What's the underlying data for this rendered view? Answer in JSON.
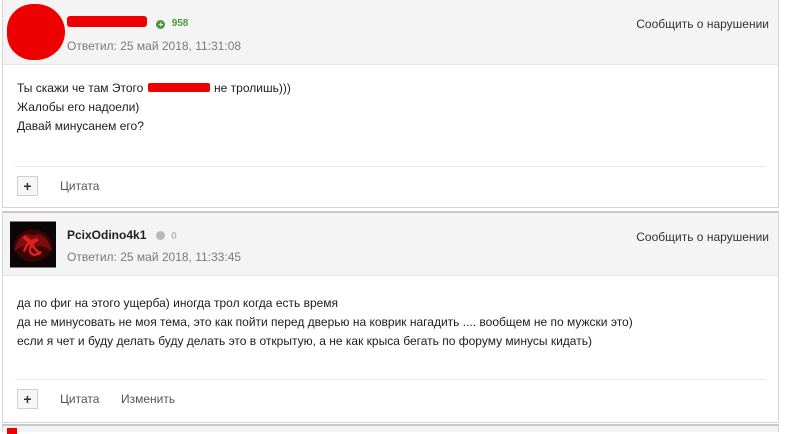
{
  "posts": [
    {
      "author": "",
      "reputation": "958",
      "reputation_color": "#4a9a3c",
      "reply_date": "Ответил: 25 май 2018, 11:31:08",
      "report": "Сообщить о нарушении",
      "lines": [
        "Ты скажи че там Этого",
        "не тролишь)))",
        "Жалобы его надоели)",
        "Давай минусанем его?"
      ],
      "actions": {
        "plus": "+",
        "quote": "Цитата"
      }
    },
    {
      "author": "PcixOdino4k1",
      "reputation": "0",
      "reputation_color": "#b8b8b8",
      "reply_date": "Ответил: 25 май 2018, 11:33:45",
      "report": "Сообщить о нарушении",
      "lines": [
        "да по фиг на этого ущерба) иногда трол когда есть время",
        "да не минусовать не моя тема, это как пойти перед дверью на коврик нагадить .... вообщем не по мужски это)",
        "если я чет и буду делать буду делать это в открытую, а не как крыса бегать по форуму минусы кидать)"
      ],
      "actions": {
        "plus": "+",
        "quote": "Цитата",
        "edit": "Изменить"
      }
    }
  ],
  "icons": {
    "plus": "plus-icon",
    "avatar": "hammer-sickle-avatar"
  },
  "colors": {
    "redaction": "#ee0000",
    "header_bg": "#f4f4f4"
  }
}
